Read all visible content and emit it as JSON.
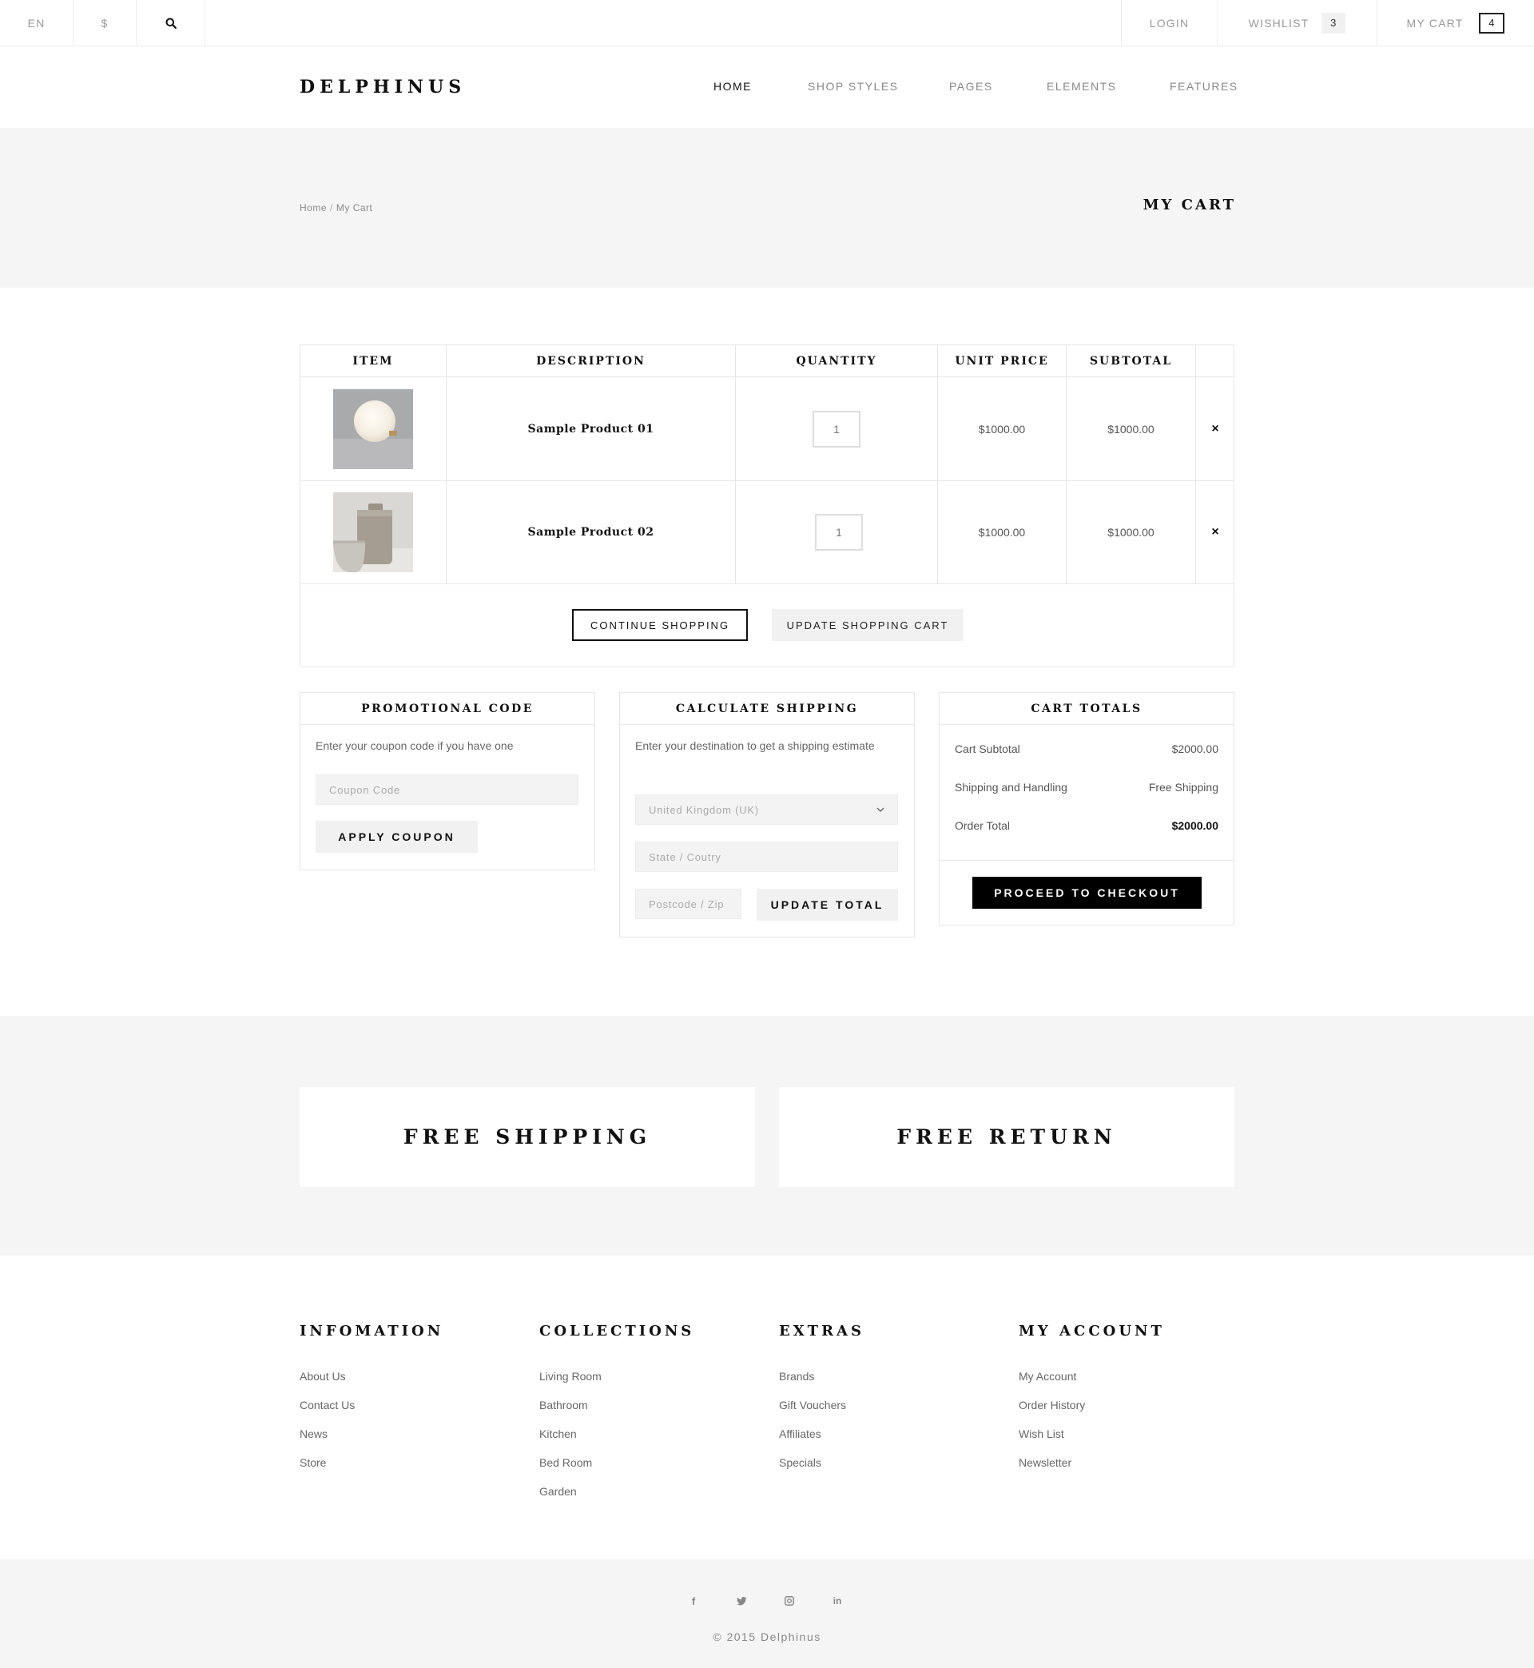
{
  "topbar": {
    "language": "EN",
    "currency": "$",
    "login": "LOGIN",
    "wishlist_label": "WISHLIST",
    "wishlist_count": "3",
    "cart_label": "MY CART",
    "cart_count": "4",
    "icons": {
      "search": "search-icon"
    }
  },
  "header": {
    "logo": "DELPHINUS",
    "nav": [
      "HOME",
      "SHOP STYLES",
      "PAGES",
      "ELEMENTS",
      "FEATURES"
    ],
    "active_nav": "HOME"
  },
  "page_title_band": {
    "breadcrumb": [
      "Home",
      "My Cart"
    ],
    "breadcrumb_sep": "/",
    "title": "MY CART"
  },
  "cart": {
    "columns": [
      "ITEM",
      "DESCRIPTION",
      "QUANTITY",
      "UNIT PRICE",
      "SUBTOTAL"
    ],
    "rows": [
      {
        "name": "Sample Product 01",
        "quantity": "1",
        "unit_price": "$1000.00",
        "subtotal": "$1000.00",
        "remove": "×"
      },
      {
        "name": "Sample Product 02",
        "quantity": "1",
        "unit_price": "$1000.00",
        "subtotal": "$1000.00",
        "remove": "×"
      }
    ],
    "continue_label": "CONTINUE SHOPPING",
    "update_label": "UPDATE SHOPPING CART"
  },
  "promo": {
    "title": "PROMOTIONAL CODE",
    "text": "Enter your coupon code if you have one",
    "placeholder": "Coupon Code",
    "button": "APPLY COUPON"
  },
  "shipping": {
    "title": "CALCULATE SHIPPING",
    "text": "Enter your destination to get a shipping estimate",
    "country": "United Kingdom (UK)",
    "state_placeholder": "State / Coutry",
    "postcode_placeholder": "Postcode / Zip",
    "button": "UPDATE TOTAL"
  },
  "totals": {
    "title": "CART TOTALS",
    "rows": [
      {
        "label": "Cart Subtotal",
        "value": "$2000.00"
      },
      {
        "label": "Shipping and Handling",
        "value": "Free Shipping"
      },
      {
        "label": "Order Total",
        "value": "$2000.00"
      }
    ],
    "checkout": "PROCEED TO CHECKOUT"
  },
  "features": [
    "FREE SHIPPING",
    "FREE RETURN"
  ],
  "footer": {
    "columns": [
      {
        "title": "INFOMATION",
        "links": [
          "About Us",
          "Contact Us",
          "News",
          "Store"
        ]
      },
      {
        "title": "COLLECTIONS",
        "links": [
          "Living Room",
          "Bathroom",
          "Kitchen",
          "Bed Room",
          "Garden"
        ]
      },
      {
        "title": "EXTRAS",
        "links": [
          "Brands",
          "Gift Vouchers",
          "Affiliates",
          "Specials"
        ]
      },
      {
        "title": "MY ACCOUNT",
        "links": [
          "My Account",
          "Order History",
          "Wish List",
          "Newsletter"
        ]
      }
    ],
    "social": [
      {
        "icon": "facebook-icon",
        "glyph": "f"
      },
      {
        "icon": "twitter-icon",
        "glyph": "🐦"
      },
      {
        "icon": "instagram-icon",
        "glyph": "◎"
      },
      {
        "icon": "linkedin-icon",
        "glyph": "in"
      }
    ],
    "copyright": "© 2015 Delphinus"
  }
}
